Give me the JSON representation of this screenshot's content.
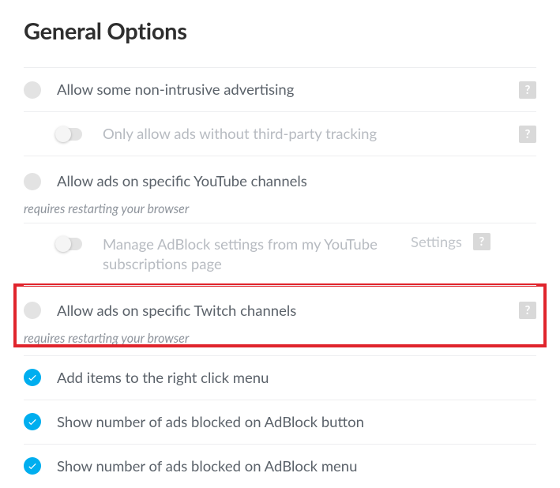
{
  "title": "General Options",
  "options": {
    "allow_non_intrusive": {
      "label": "Allow some non-intrusive advertising",
      "sub": {
        "label": "Only allow ads without third-party tracking"
      }
    },
    "youtube": {
      "label": "Allow ads on specific YouTube channels",
      "note": "requires restarting your browser",
      "sub": {
        "label": "Manage AdBlock settings from my YouTube subscriptions page",
        "settings": "Settings"
      }
    },
    "twitch": {
      "label": "Allow ads on specific Twitch channels",
      "note": "requires restarting your browser"
    },
    "right_click": {
      "label": "Add items to the right click menu"
    },
    "button_count": {
      "label": "Show number of ads blocked on AdBlock button"
    },
    "menu_count": {
      "label": "Show number of ads blocked on AdBlock menu"
    }
  },
  "help_glyph": "?"
}
